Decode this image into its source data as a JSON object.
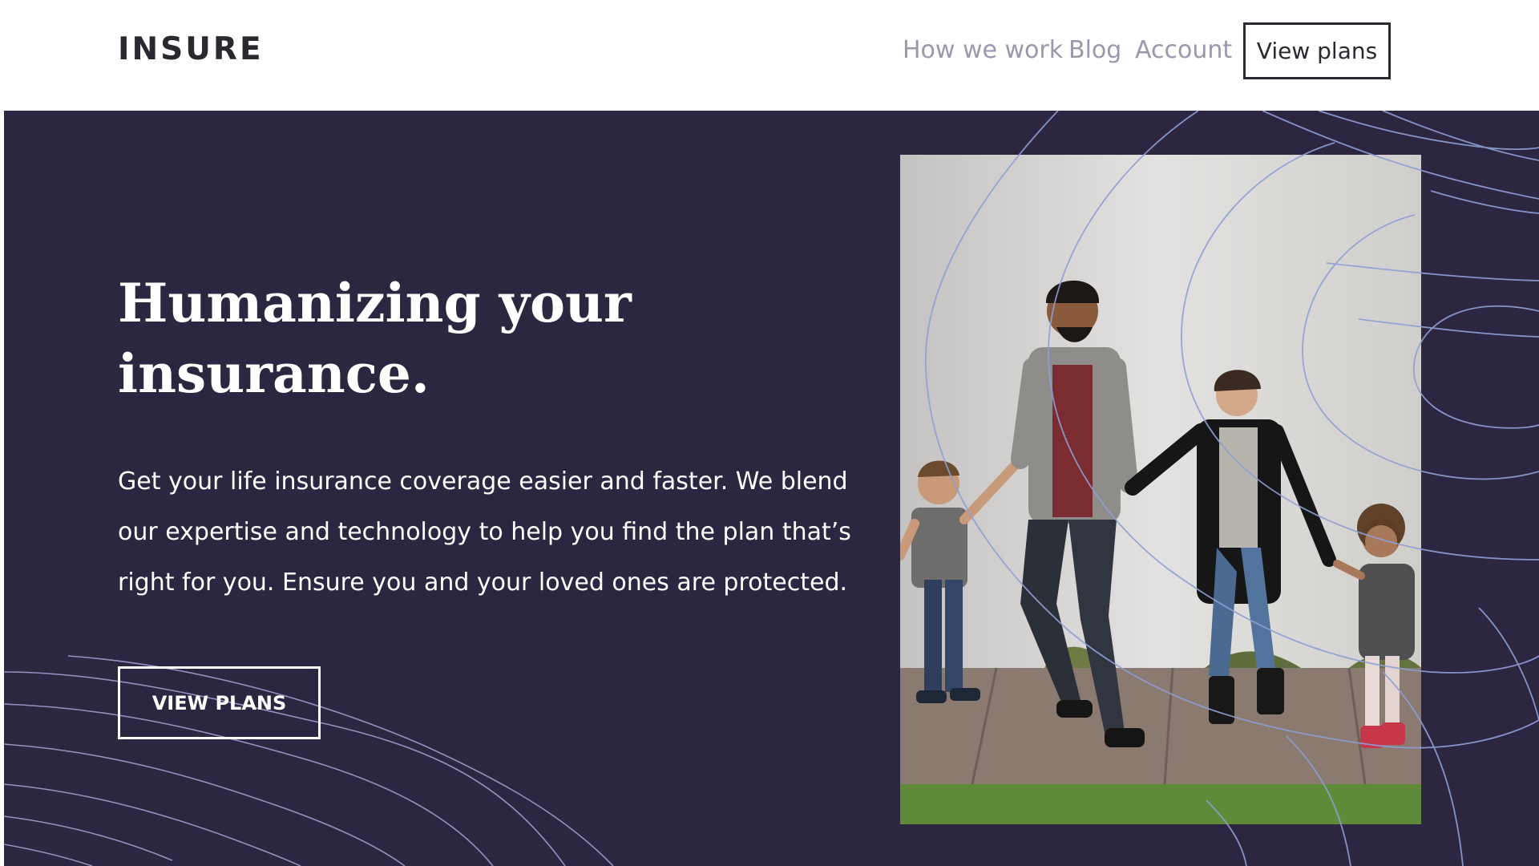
{
  "header": {
    "logo": "INSURE",
    "nav": [
      {
        "label": "How we work"
      },
      {
        "label": "Blog"
      },
      {
        "label": "Account"
      }
    ],
    "cta_label": "View plans"
  },
  "hero": {
    "title": "Humanizing your insurance.",
    "description": "Get your life insurance coverage easier and faster. We blend our expertise and technology to help you find the plan that’s right for you. Ensure you and your loved ones are protected.",
    "cta_label": "VIEW PLANS",
    "photo_alt": "Family of four walking hand in hand along a sidewalk"
  },
  "colors": {
    "hero_bg": "#2d2640",
    "dark_text": "#2c2830",
    "nav_text": "#9a98ad",
    "line_accent": "#8f9fd4"
  }
}
